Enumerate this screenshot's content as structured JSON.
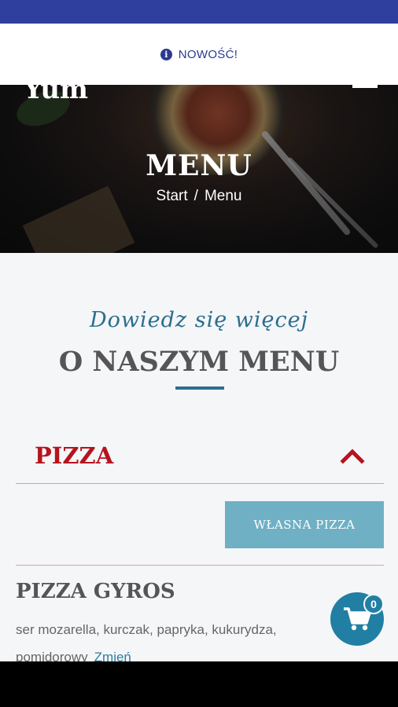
{
  "notice": {
    "icon": "info-icon",
    "text": "NOWOŚĆ!"
  },
  "hero": {
    "logo_partial": "Yum",
    "title": "MENU",
    "breadcrumb": {
      "start": "Start",
      "separator": "/",
      "current": "Menu"
    }
  },
  "section": {
    "subtitle": "Dowiedz się więcej",
    "title": "O NASZYM MENU"
  },
  "category": {
    "title": "PIZZA",
    "toggle_icon": "chevron-up-icon"
  },
  "own_pizza_button": "WŁASNA PIZZA",
  "item": {
    "name": "PIZZA GYROS",
    "description": "ser mozarella, kurczak, papryka, kukurydza, pomidorowy",
    "change_link": "Zmień"
  },
  "cart": {
    "icon": "cart-icon",
    "count": "0"
  },
  "colors": {
    "status_bar": "#2f3f9e",
    "accent_blue": "#2b6e8e",
    "category_red": "#b5141e",
    "button_teal": "#6fb0c4",
    "cart_blue": "#217fa4"
  }
}
